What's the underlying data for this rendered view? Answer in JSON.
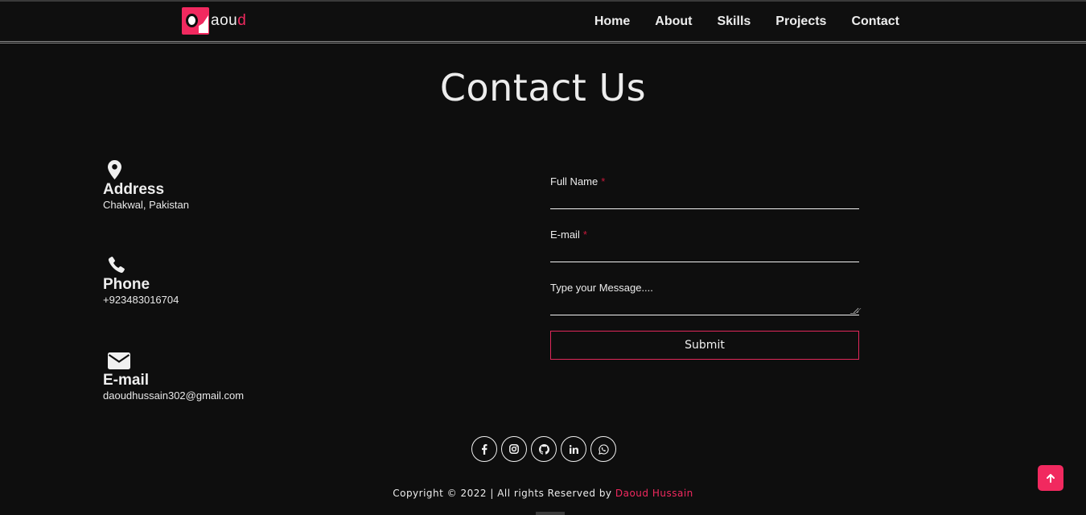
{
  "nav": {
    "logo_first": "aou",
    "logo_last": "d",
    "links": [
      "Home",
      "About",
      "Skills",
      "Projects",
      "Contact"
    ]
  },
  "page_title": "Contact Us",
  "contact": {
    "address": {
      "heading": "Address",
      "value": "Chakwal, Pakistan",
      "icon": "map-pin-icon"
    },
    "phone": {
      "heading": "Phone",
      "value": "+923483016704",
      "icon": "phone-icon"
    },
    "email": {
      "heading": "E-mail",
      "value": "daoudhussain302@gmail.com",
      "icon": "envelope-icon"
    }
  },
  "form": {
    "full_name_label": "Full Name",
    "email_label": "E-mail",
    "required_mark": "*",
    "message_label": "Type your Message....",
    "submit_label": "Submit"
  },
  "socials": [
    "facebook-icon",
    "instagram-icon",
    "github-icon",
    "linkedin-icon",
    "whatsapp-icon"
  ],
  "footer": {
    "copyright_text": "Copyright © 2022 | All rights Reserved by",
    "author": "Daoud Hussain"
  },
  "colors": {
    "accent": "#f1295f",
    "background": "#0e0e0e",
    "text": "#ececec"
  }
}
